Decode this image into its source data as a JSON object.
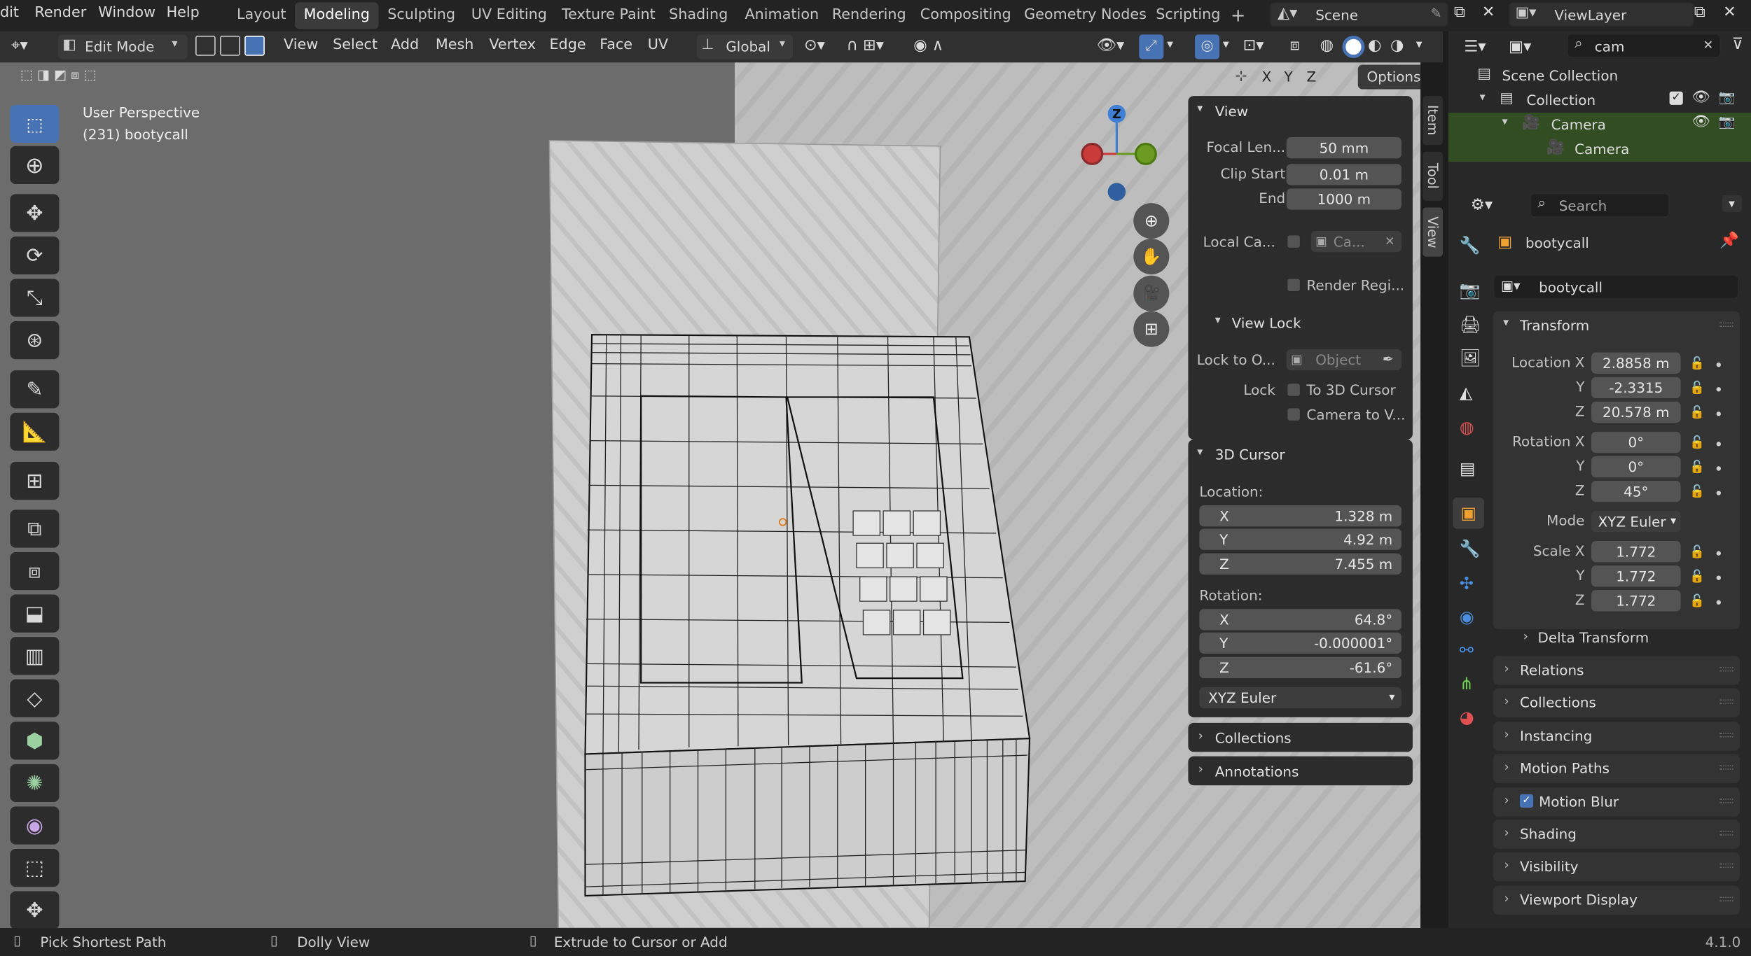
{
  "menu": [
    "dit",
    "Render",
    "Window",
    "Help"
  ],
  "workspaces": [
    "Layout",
    "Modeling",
    "Sculpting",
    "UV Editing",
    "Texture Paint",
    "Shading",
    "Animation",
    "Rendering",
    "Compositing",
    "Geometry Nodes",
    "Scripting"
  ],
  "active_workspace": "Modeling",
  "add_workspace": "+",
  "scene": {
    "name": "Scene"
  },
  "viewlayer": {
    "name": "ViewLayer"
  },
  "header": {
    "mode": "Edit Mode",
    "menus": [
      "View",
      "Select",
      "Add",
      "Mesh",
      "Vertex",
      "Edge",
      "Face",
      "UV"
    ],
    "orientation": "Global",
    "options": "Options",
    "axes": [
      "X",
      "Y",
      "Z"
    ]
  },
  "viewport": {
    "perspective": "User Perspective",
    "object_info": "(231) bootycall",
    "gizmo_z": "Z"
  },
  "npanel": {
    "tabs": [
      "Item",
      "Tool",
      "View"
    ],
    "view": {
      "title": "View",
      "focal_label": "Focal Len...",
      "focal_value": "50 mm",
      "clip_start_label": "Clip Start",
      "clip_start_value": "0.01 m",
      "end_label": "End",
      "end_value": "1000 m",
      "local_camera_label": "Local Ca...",
      "local_camera_value": "Ca...",
      "render_region": "Render Regi...",
      "view_lock_title": "View Lock",
      "lock_to_object_label": "Lock to O...",
      "lock_to_object_value": "Object",
      "lock_label": "Lock",
      "to_3d_cursor": "To 3D Cursor",
      "camera_to_view": "Camera to V..."
    },
    "cursor": {
      "title": "3D Cursor",
      "location_label": "Location:",
      "loc": [
        {
          "axis": "X",
          "value": "1.328 m"
        },
        {
          "axis": "Y",
          "value": "4.92 m"
        },
        {
          "axis": "Z",
          "value": "7.455 m"
        }
      ],
      "rotation_label": "Rotation:",
      "rot": [
        {
          "axis": "X",
          "value": "64.8°"
        },
        {
          "axis": "Y",
          "value": "-0.000001°"
        },
        {
          "axis": "Z",
          "value": "-61.6°"
        }
      ],
      "mode": "XYZ Euler"
    },
    "collections": "Collections",
    "annotations": "Annotations"
  },
  "outliner": {
    "search": "cam",
    "items": [
      {
        "label": "Scene Collection"
      },
      {
        "label": "Collection"
      },
      {
        "label": "Camera"
      },
      {
        "label": "Camera"
      }
    ]
  },
  "properties": {
    "search_placeholder": "Search",
    "object_name": "bootycall",
    "data_name": "bootycall",
    "transform_title": "Transform",
    "location": [
      {
        "label": "Location X",
        "value": "2.8858 m"
      },
      {
        "label": "Y",
        "value": "-2.3315"
      },
      {
        "label": "Z",
        "value": "20.578 m"
      }
    ],
    "rotation": [
      {
        "label": "Rotation X",
        "value": "0°"
      },
      {
        "label": "Y",
        "value": "0°"
      },
      {
        "label": "Z",
        "value": "45°"
      }
    ],
    "mode_label": "Mode",
    "mode_value": "XYZ Euler",
    "scale": [
      {
        "label": "Scale X",
        "value": "1.772"
      },
      {
        "label": "Y",
        "value": "1.772"
      },
      {
        "label": "Z",
        "value": "1.772"
      }
    ],
    "delta_transform": "Delta Transform",
    "sections": [
      "Relations",
      "Collections",
      "Instancing",
      "Motion Paths",
      "Motion Blur",
      "Shading",
      "Visibility",
      "Viewport Display"
    ]
  },
  "status": {
    "left": "Pick Shortest Path",
    "middle": "Dolly View",
    "right": "Extrude to Cursor or Add",
    "version": "4.1.0"
  },
  "colors": {
    "accent": "#4772b3",
    "selected_row": "#334d22",
    "axis_x": "#c93b3b",
    "axis_y": "#6b9a20",
    "axis_z": "#3f7fd6"
  }
}
